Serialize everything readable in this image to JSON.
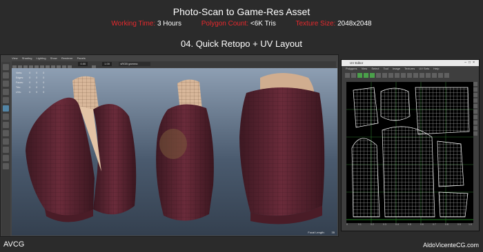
{
  "header": {
    "title": "Photo-Scan to Game-Res Asset",
    "stats": [
      {
        "label": "Working Time:",
        "value": "3 Hours"
      },
      {
        "label": "Polygon Count:",
        "value": "<6K Tris"
      },
      {
        "label": "Texture Size:",
        "value": "2048x2048"
      }
    ],
    "subtitle": "04. Quick Retopo + UV Layout"
  },
  "maya": {
    "menu": [
      "View",
      "Shading",
      "Lighting",
      "Show",
      "Renderer",
      "Panels"
    ],
    "field_a": "0.00",
    "field_b": "1.00",
    "colorspace": "sRGB gamma",
    "hud_labels": [
      "Verts:",
      "Edges:",
      "Faces:",
      "Tris:",
      "UVs:"
    ],
    "hud_values": [
      "0",
      "0",
      "0",
      "0",
      "0"
    ],
    "focal_label": "Focal Length:",
    "focal_value": "35"
  },
  "uv_editor": {
    "title": "UV Editor",
    "menu": [
      "Polygons",
      "View",
      "Select",
      "Tool",
      "Image",
      "Textures",
      "UV Sets",
      "Help"
    ],
    "axis_ticks": [
      "0",
      "0.1",
      "0.2",
      "0.3",
      "0.4",
      "0.5",
      "0.6",
      "0.7",
      "0.8",
      "0.9",
      "1.0"
    ]
  },
  "footer": {
    "left": "AVCG",
    "right": "AldoVicenteCG.com"
  },
  "colors": {
    "accent_red": "#e8292d",
    "jacket": "#5a2330"
  }
}
